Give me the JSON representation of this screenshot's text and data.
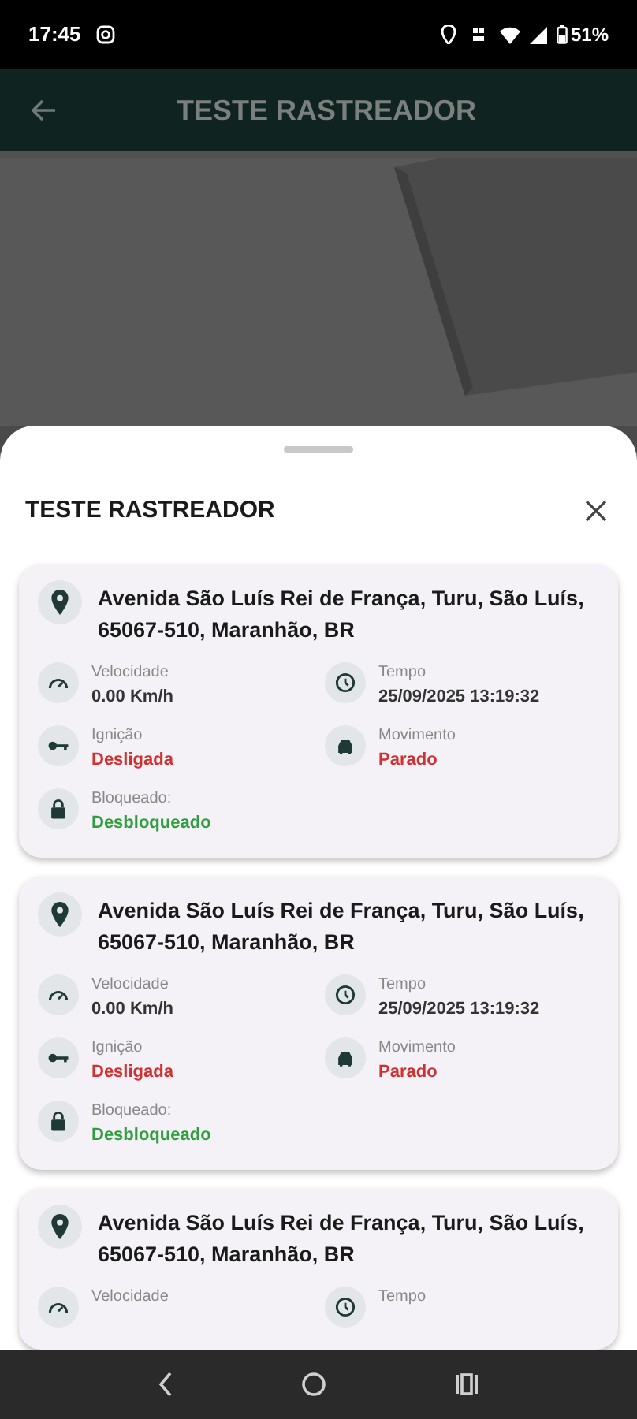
{
  "status_bar": {
    "time": "17:45",
    "battery": "51%"
  },
  "app_bar": {
    "title": "TESTE RASTREADOR"
  },
  "sheet": {
    "title": "TESTE RASTREADOR",
    "cards": [
      {
        "address": "Avenida São Luís Rei de França, Turu, São Luís, 65067-510, Maranhão, BR",
        "fields": [
          {
            "kind": "speed",
            "label": "Velocidade",
            "value": "0.00 Km/h",
            "color": "#333333"
          },
          {
            "kind": "clock",
            "label": "Tempo",
            "value": "25/09/2025 13:19:32",
            "color": "#333333"
          },
          {
            "kind": "key",
            "label": "Ignição",
            "value": "Desligada",
            "color": "#d32f2f"
          },
          {
            "kind": "car",
            "label": "Movimento",
            "value": "Parado",
            "color": "#d32f2f"
          },
          {
            "kind": "lock",
            "label": "Bloqueado:",
            "value": "Desbloqueado",
            "color": "#2e9e3e"
          }
        ]
      },
      {
        "address": "Avenida São Luís Rei de França, Turu, São Luís, 65067-510, Maranhão, BR",
        "fields": [
          {
            "kind": "speed",
            "label": "Velocidade",
            "value": "0.00 Km/h",
            "color": "#333333"
          },
          {
            "kind": "clock",
            "label": "Tempo",
            "value": "25/09/2025 13:19:32",
            "color": "#333333"
          },
          {
            "kind": "key",
            "label": "Ignição",
            "value": "Desligada",
            "color": "#d32f2f"
          },
          {
            "kind": "car",
            "label": "Movimento",
            "value": "Parado",
            "color": "#d32f2f"
          },
          {
            "kind": "lock",
            "label": "Bloqueado:",
            "value": "Desbloqueado",
            "color": "#2e9e3e"
          }
        ]
      },
      {
        "address": "Avenida São Luís Rei de França, Turu, São Luís, 65067-510, Maranhão, BR",
        "fields": [
          {
            "kind": "speed",
            "label": "Velocidade"
          },
          {
            "kind": "clock",
            "label": "Tempo"
          }
        ]
      }
    ]
  }
}
